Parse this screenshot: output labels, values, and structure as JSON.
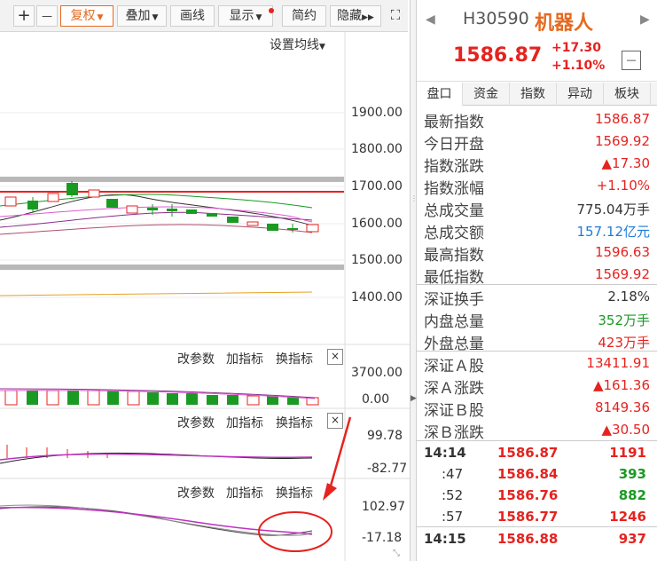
{
  "toolbar": {
    "plus": "+",
    "minus": "—",
    "fuquan": "复权",
    "diejia": "叠加",
    "huaxian": "画线",
    "xianshi": "显示",
    "jianyue": "简约",
    "yincang": "隐藏"
  },
  "chart": {
    "ma_setting": "设置均线",
    "price_axis": [
      "1900.00",
      "1800.00",
      "1700.00",
      "1600.00",
      "1500.00",
      "1400.00"
    ],
    "vol_axis": [
      "3700.00",
      "0.00"
    ],
    "ind1_axis": [
      "99.78",
      "-82.77"
    ],
    "ind2_axis": [
      "102.97",
      "-17.18"
    ],
    "panel_btns": {
      "param": "改参数",
      "add": "加指标",
      "swap": "换指标",
      "close": "×"
    }
  },
  "quote": {
    "code": "H30590",
    "name": "机器人",
    "price": "1586.87",
    "change": "+17.30",
    "change_pct": "+1.10%",
    "collapse": "—"
  },
  "tabs": [
    "盘口",
    "资金",
    "指数",
    "异动",
    "板块"
  ],
  "panel_rows": [
    {
      "label": "最新指数",
      "value": "1586.87",
      "color": "red"
    },
    {
      "label": "今日开盘",
      "value": "1569.92",
      "color": "red"
    },
    {
      "label": "指数涨跌",
      "value": "▲17.30",
      "color": "red"
    },
    {
      "label": "指数涨幅",
      "value": "+1.10%",
      "color": "red"
    },
    {
      "label": "总成交量",
      "value": "775.04万手",
      "color": "dark"
    },
    {
      "label": "总成交额",
      "value": "157.12亿元",
      "color": "blue"
    },
    {
      "label": "最高指数",
      "value": "1596.63",
      "color": "red"
    },
    {
      "label": "最低指数",
      "value": "1569.92",
      "color": "red"
    },
    {
      "label": "深证换手",
      "value": "2.18%",
      "color": "dark"
    },
    {
      "label": "内盘总量",
      "value": "352万手",
      "color": "green"
    },
    {
      "label": "外盘总量",
      "value": "423万手",
      "color": "red"
    },
    {
      "label": "深证Ａ股",
      "value": "13411.91",
      "color": "red"
    },
    {
      "label": "深Ａ涨跌",
      "value": "▲161.36",
      "color": "red"
    },
    {
      "label": "深证Ｂ股",
      "value": "8149.36",
      "color": "red"
    },
    {
      "label": "深Ｂ涨跌",
      "value": "▲30.50",
      "color": "red"
    }
  ],
  "ticks": [
    {
      "time": "14:14",
      "price": "1586.87",
      "vol": "1191",
      "vcolor": "red",
      "full": true
    },
    {
      "time": ":47",
      "price": "1586.84",
      "vol": "393",
      "vcolor": "green",
      "full": false
    },
    {
      "time": ":52",
      "price": "1586.76",
      "vol": "882",
      "vcolor": "green",
      "full": false
    },
    {
      "time": ":57",
      "price": "1586.77",
      "vol": "1246",
      "vcolor": "red",
      "full": false
    },
    {
      "time": "14:15",
      "price": "1586.88",
      "vol": "937",
      "vcolor": "red",
      "full": true
    }
  ],
  "colors": {
    "up": "#e5231f",
    "down": "#1a9a23",
    "blue": "#1e7bd6",
    "accent": "#e66a1f"
  }
}
